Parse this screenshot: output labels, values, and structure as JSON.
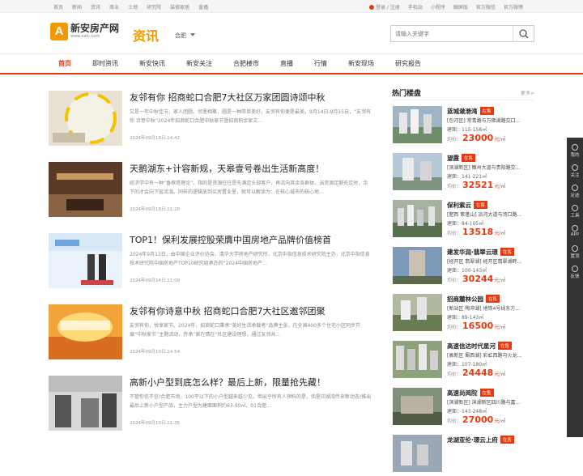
{
  "topbar": {
    "left_links": [
      "首页",
      "新闻",
      "资讯",
      "商业",
      "土地",
      "研究院",
      "装修家居",
      "直播"
    ],
    "login": "登录 / 注册",
    "right_links": [
      "手机站",
      "小程序",
      "触屏版",
      "官方微信",
      "官方微博"
    ]
  },
  "header": {
    "logo_mark": "A",
    "logo_cn": "新安房产网",
    "logo_en": "www.xafc.com",
    "channel": "资讯",
    "city": "合肥",
    "search_placeholder": "请输入关键字"
  },
  "nav": [
    "首页",
    "即时资讯",
    "新安快讯",
    "新安关注",
    "合肥楼市",
    "直播",
    "行情",
    "新安现场",
    "研究报告"
  ],
  "articles": [
    {
      "title": "友邻有你 招商蛇口合肥7大社区万家团圆诗颂中秋",
      "desc": "又是一年中秋佳节，家人团圆，邻里相聚，圆是一种简单美好，友邻有你便是最美。9月14日-9月15日，“友邻有你 诗意中秋”2024年招商蛇口合肥中秋家节暨招商积余家文...",
      "date": "2024年09月18日 14:42"
    },
    {
      "title": "天鹅湖东+计容新规，天皋壹号卷出生活新高度！",
      "desc": "经济学中有一种“香槟塔理论”，指的是资源往往是先满足头部客户，再流向其余各群体，当资源足够充足时，余下的才会向下层流淌。同样的逻辑放到买房置业里，就可以解读为：在核心城市的核心地...",
      "date": "2024年09月18日 11:26"
    },
    {
      "title": "TOP1！保利发展控股荣膺中国房地产品牌价值榜首",
      "desc": "2024年9月13日，由中国企业评价协会、清华大学房地产研究所、北京中指信息技术研究院主办，北京中指信息技术研究院中国房地产TOP10研究组承办的“2024中国房地产...",
      "date": "2024年09月14日 11:09"
    },
    {
      "title": "友邻有你诗意中秋 招商蛇口合肥7大社区邀邻团聚",
      "desc": "友邻有你，悦享家节。2024年，招商蛇口秉承“美好生活承载者”品牌主张，在全国400多个住宅小区同步开展“中秋家节”主题活动，传承“家在情在”社区建设理想，通过友邻共...",
      "date": "2024年09月10日 14:54"
    },
    {
      "title": "高新小户型到底怎么样？最后上新，限量抢先藏！",
      "desc": "不管你信不信!合肥市场，100平以下的小户型越来越少见。但出乎所有人预料的是，伟星印湖湾传来新动态!推出最后上新小户型产品，主力户型为建面面积约63-90㎡，01合肥...",
      "date": "2024年09月10日 11:35"
    }
  ],
  "sidebar": {
    "title": "热门楼盘",
    "more": "更多>",
    "price_label": "均价：",
    "price_unit": "元/㎡",
    "items": [
      {
        "name": "蓝城潋滟湾",
        "badge": "在售",
        "addr": "[包河区] 常青路与万佛湖路交口...",
        "area": "建面：115-158㎡",
        "price": "23000"
      },
      {
        "name": "望霞",
        "badge": "在售",
        "addr": "[滨湖新区] 徽州大道与贵阳路交...",
        "area": "建面：141-221㎡",
        "price": "32521"
      },
      {
        "name": "保利紫云",
        "badge": "在售",
        "addr": "[肥西 紫蓬山] 派河大道与汤口路...",
        "area": "建面：84-105㎡",
        "price": "13518"
      },
      {
        "name": "建发华润·翡翠云璟",
        "badge": "在售",
        "addr": "[经开区 翡翠湖] 经开区翡翠湖畔...",
        "area": "建面：100-143㎡",
        "price": "30244"
      },
      {
        "name": "招商麓林公园",
        "badge": "在售",
        "addr": "[新站区 陶冲湖] 地铁4号线东方...",
        "area": "建面：89-143㎡",
        "price": "16500"
      },
      {
        "name": "高速信达时代星河",
        "badge": "在售",
        "addr": "[高新区 蜀西湖] 彩虹西路与火龙...",
        "area": "建面：107-180㎡",
        "price": "24448"
      },
      {
        "name": "高速尚阅院",
        "badge": "在售",
        "addr": "[滨湖新区] 滨湖新区四川路与嘉...",
        "area": "建面：143-248㎡",
        "price": "27000"
      },
      {
        "name": "龙湖亚伦·璟云上府",
        "badge": "在售",
        "addr": "",
        "area": "",
        "price": ""
      }
    ]
  },
  "rail": [
    "我的",
    "关注",
    "足迹",
    "工具",
    "APP",
    "置顶",
    "反馈"
  ],
  "colors": {
    "accent": "#e8380d",
    "brand": "#f39800"
  }
}
